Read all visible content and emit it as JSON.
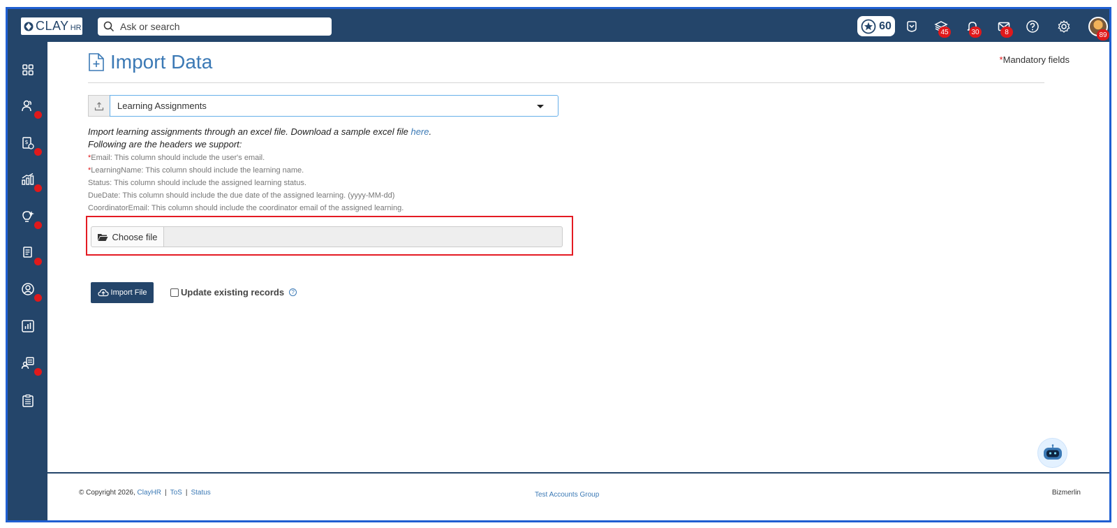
{
  "brand": {
    "logo_word": "CLAY",
    "logo_suffix": "HR"
  },
  "search": {
    "placeholder": "Ask or search"
  },
  "topbar": {
    "points": "60",
    "badges": {
      "layers": "45",
      "notifications": "30",
      "messages": "8",
      "avatar": "89"
    }
  },
  "page": {
    "title": "Import Data",
    "mandatory_star": "*",
    "mandatory_label": "Mandatory fields"
  },
  "import_type": {
    "selected": "Learning Assignments"
  },
  "instructions": {
    "line1_prefix": "Import learning assignments through an excel file. Download a sample excel file ",
    "line1_link": "here",
    "line1_suffix": ".",
    "line2": "Following are the headers we support:"
  },
  "headers_list": [
    {
      "star": "*",
      "text": "Email: This column should include the user's email."
    },
    {
      "star": "*",
      "text": "LearningName: This column should include the learning name."
    },
    {
      "star": "",
      "text": "Status: This column should include the assigned learning status."
    },
    {
      "star": "",
      "text": "DueDate: This column should include the due date of the assigned learning. (yyyy-MM-dd)"
    },
    {
      "star": "",
      "text": "CoordinatorEmail: This column should include the coordinator email of the assigned learning."
    }
  ],
  "file_input": {
    "button_label": "Choose file",
    "filename": ""
  },
  "actions": {
    "import_label": "Import File",
    "update_label": "Update existing records",
    "help_glyph": "?"
  },
  "footer": {
    "copyright": "© Copyright 2026,",
    "company_link": "ClayHR",
    "tos": "ToS",
    "status": "Status",
    "sep": "|",
    "group": "Test Accounts Group",
    "tenant": "Bizmerlin"
  },
  "icons": {
    "sidebar": [
      "dashboard-icon",
      "people-icon",
      "payroll-icon",
      "performance-icon",
      "learning-icon",
      "documents-icon",
      "profile-icon",
      "reports-icon",
      "onboarding-icon",
      "checklist-icon"
    ],
    "topbar": [
      "star-icon",
      "alarm-icon",
      "layers-icon",
      "bell-icon",
      "mail-icon",
      "help-icon",
      "gear-icon"
    ]
  },
  "colors": {
    "nav": "#24456a",
    "accent": "#3b79b5",
    "badge": "#e0191b",
    "highlight": "#e41b23"
  }
}
